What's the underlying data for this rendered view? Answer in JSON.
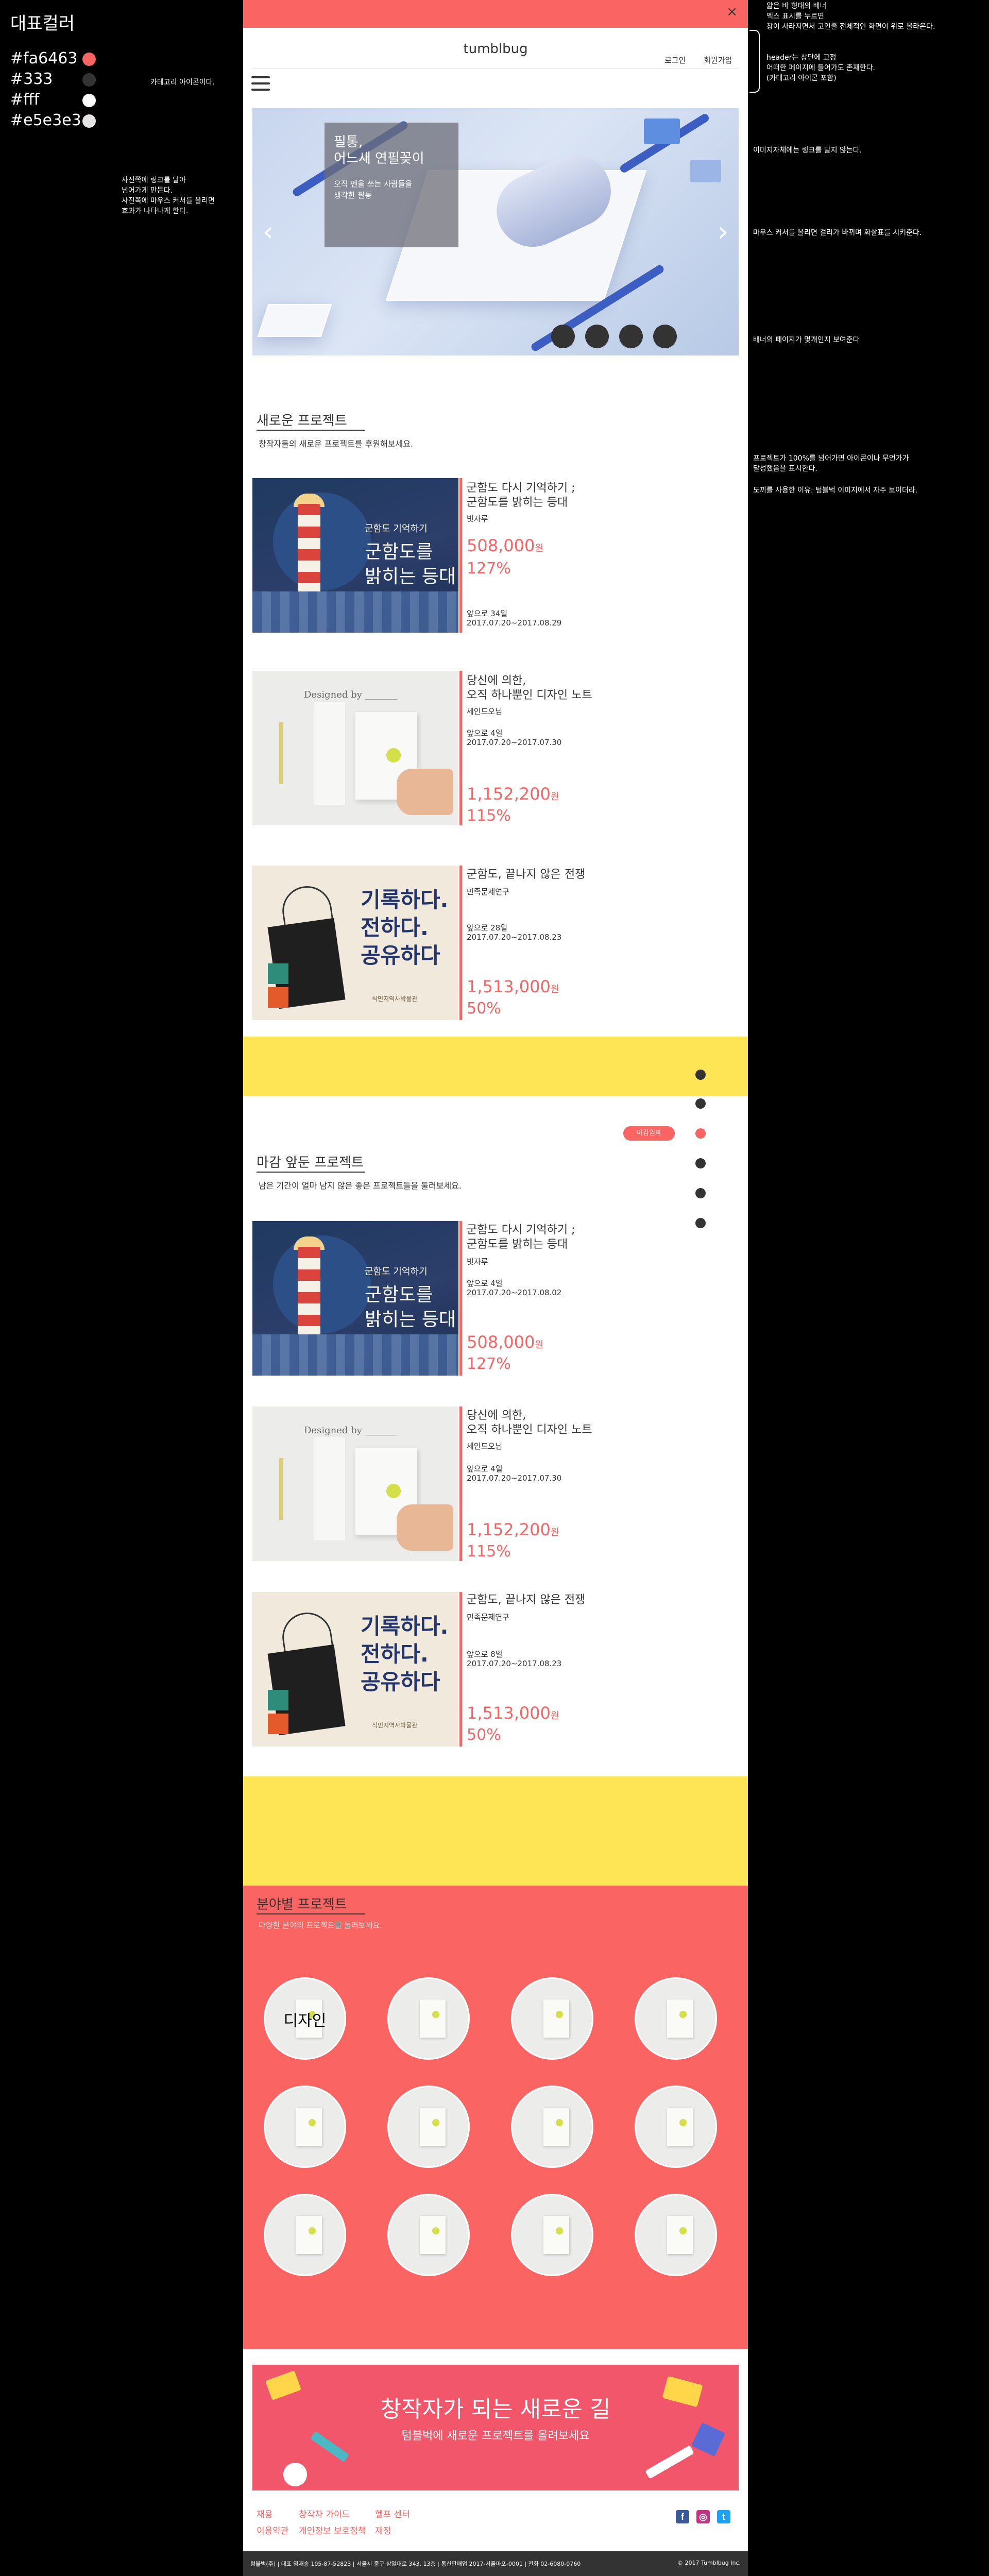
{
  "palette": {
    "title": "대표컬러",
    "colors": [
      {
        "label": "#fa6463",
        "hex": "#fa6463"
      },
      {
        "label": "#333",
        "hex": "#333333"
      },
      {
        "label": "#fff",
        "hex": "#ffffff"
      },
      {
        "label": "#e5e3e3",
        "hex": "#e5e3e3"
      }
    ]
  },
  "notes": {
    "category_icon": "카테고리 아이콘이다.",
    "photo_link": "사진쪽에 링크를 달아\n넘어가게 만든다.\n사진쪽에 마우스 커서를 올리면\n효과가 나타나게 한다.",
    "top_banner": "얇은 바 형태의 배너\n엑스 표시를 누르면\n창이 사라지면서 고인줄 전체적인 화면이 위로 올라온다.",
    "header_fixed": "header는 상단에 고정\n어떠한 페이지에 들어가도 존재한다.\n(카테고리 아이콘 포함)",
    "no_link": "이미지자체에는 링크를 달지 않는다.",
    "hover_arrows": "마우스 커서를 올리면 걸리가 바뀌며 화살표를 시키준다.",
    "page_indicator": "배너의 페이지가 몇개인지 보여준다",
    "progress_icon": "프로젝트가 100%를 넘어가면 아이콘이나 무언가가\n달성했음을 표시한다.",
    "thumb_reason": "도끼를 사용한 이유: 텀블벅 이미지에서 자주 보이더라."
  },
  "topbanner": {
    "close_label": "×"
  },
  "header": {
    "logo": "tumblbug",
    "login": "로그인",
    "signup": "회원가입"
  },
  "hero": {
    "caption_title": "필통,\n어느새 연필꽂이",
    "caption_sub": "오직 펜을 쓰는 사람들을\n생각한 필통",
    "prev": "‹",
    "next": "›",
    "slide_count": 4
  },
  "new_projects": {
    "title": "새로운 프로젝트",
    "subtitle": "창작자들의 새로운 프로젝트를 후원해보세요.",
    "items": [
      {
        "title": "군함도 다시 기억하기 ;\n군함도를 밝히는 등대",
        "author": "빗자루",
        "days": "앞으로 34일",
        "dates": "2017.07.20~2017.08.29",
        "amount": "508,000",
        "unit": "원",
        "percent": "127%"
      },
      {
        "title": "당신에 의한,\n오직 하나뿐인 디자인 노트",
        "author": "세인드오님",
        "days": "앞으로 4일",
        "dates": "2017.07.20~2017.07.30",
        "amount": "1,152,200",
        "unit": "원",
        "percent": "115%"
      },
      {
        "title": "군함도, 끝나지 않은 전쟁",
        "author": "민족문제연구",
        "days": "앞으로 28일",
        "dates": "2017.07.20~2017.08.23",
        "amount": "1,513,000",
        "unit": "원",
        "percent": "50%"
      }
    ]
  },
  "closing_projects": {
    "tag": "마감임박",
    "title": "마감 앞둔 프로젝트",
    "subtitle": "남은 기간이 얼마 남지 않은 좋은 프로젝트들을 둘러보세요.",
    "items": [
      {
        "title": "군함도 다시 기억하기 ;\n군함도를 밝히는 등대",
        "author": "빗자루",
        "days": "앞으로 4일",
        "dates": "2017.07.20~2017.08.02",
        "amount": "508,000",
        "unit": "원",
        "percent": "127%"
      },
      {
        "title": "당신에 의한,\n오직 하나뿐인 디자인 노트",
        "author": "세인드오님",
        "days": "앞으로 4일",
        "dates": "2017.07.20~2017.07.30",
        "amount": "1,152,200",
        "unit": "원",
        "percent": "115%"
      },
      {
        "title": "군함도, 끝나지 않은 전쟁",
        "author": "민족문제연구",
        "days": "앞으로 8일",
        "dates": "2017.07.20~2017.08.23",
        "amount": "1,513,000",
        "unit": "원",
        "percent": "50%"
      }
    ]
  },
  "image_text": {
    "light_small": "군함도 기억하기",
    "light_big": "군함도를\n밝히는 등대",
    "note_designed": "Designed by _______",
    "bag_slogan": "기록하다.\n전하다.\n공유하다",
    "bag_org": "식민지역사박물관"
  },
  "categories": {
    "title": "분야별 프로젝트",
    "subtitle": "다양한 분야의 프로젝트를 둘러보세요.",
    "first_label": "디자인"
  },
  "bottom_banner": {
    "title": "창작자가 되는 새로운 길",
    "subtitle": "텀블벅에 새로운 프로젝트를 올려보세요"
  },
  "footer": {
    "links_row1": [
      "채용",
      "창작자 가이드",
      "헬프 센터"
    ],
    "links_row2": [
      "이용약관",
      "개인정보 보호정책",
      "재정"
    ],
    "social": [
      "f",
      "◎",
      "t"
    ],
    "info": "텀블벅(주) | 대표 염재승 105-87-52823 | 서울시 중구 삼일대로 343, 13층 | 통신판매업 2017-서울마포-0001 | 전화 02-6080-0760",
    "copyright": "© 2017 Tumblbug Inc."
  }
}
